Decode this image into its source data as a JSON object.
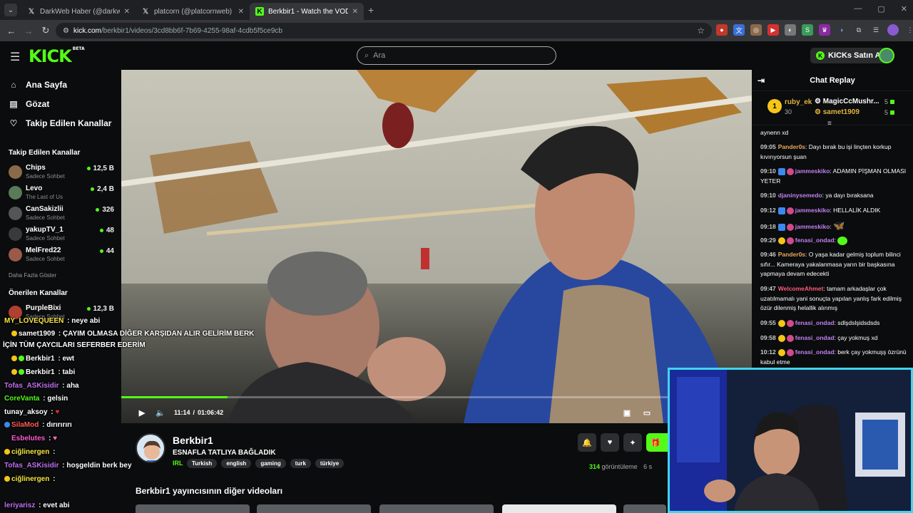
{
  "browser": {
    "tabs": [
      {
        "title": "DarkWeb Haber (@darkwebhaber) / X",
        "icon": "x-icon"
      },
      {
        "title": "platcorn (@platcornweb) / X",
        "icon": "x-icon"
      },
      {
        "title": "Berkbir1 - Watch the VOD on Kick",
        "icon": "kick-icon"
      }
    ],
    "url_host": "kick.com",
    "url_path": "/berkbir1/videos/3cd8bb6f-7b69-4255-98af-4cdb5f5ce9cb"
  },
  "header": {
    "logo": "KICK",
    "logo_badge": "BETA",
    "search_placeholder": "Ara",
    "buy_label": "KICKs Satın Al"
  },
  "sidebar": {
    "nav": [
      {
        "label": "Ana Sayfa",
        "icon": "home-icon"
      },
      {
        "label": "Gözat",
        "icon": "browse-icon"
      },
      {
        "label": "Takip Edilen Kanallar",
        "icon": "heart-icon"
      }
    ],
    "followed_heading": "Takip Edilen Kanallar",
    "followed": [
      {
        "name": "Chips",
        "category": "Sadece Sohbet",
        "viewers": "12,5 B",
        "color": "#8a6a4a"
      },
      {
        "name": "Levo",
        "category": "The Last of Us",
        "viewers": "2,4 B",
        "color": "#5a7a5a"
      },
      {
        "name": "CanSakizlii",
        "category": "Sadece Sohbet",
        "viewers": "326",
        "color": "#555555"
      },
      {
        "name": "yakupTV_1",
        "category": "Sadece Sohbet",
        "viewers": "48",
        "color": "#3a3a3a"
      },
      {
        "name": "MelFred22",
        "category": "Sadece Sohbet",
        "viewers": "44",
        "color": "#9a5a4a"
      }
    ],
    "more_label": "Daha Fazla Göster",
    "recommended_heading": "Önerilen Kanallar",
    "recommended_top": {
      "name": "PurpleBixi",
      "category": "Sadece Sohbet",
      "viewers": "12,3 B",
      "color": "#b04030"
    }
  },
  "overlay_chat": [
    {
      "user": "MY_LOVEQUEEN",
      "text": " : neye abi",
      "color": "#f5e642"
    },
    {
      "user": "samet1909",
      "text": " : ÇAYIM OLMASA DİĞER KARŞIDAN ALIR GELİRİM BERK",
      "color": "#ffffff"
    },
    {
      "user": "",
      "text": "İÇİN TÜM ÇAYCILARI SEFERBER EDERİM",
      "color": "#ffffff"
    },
    {
      "user": "Berkbir1",
      "text": " : ewt",
      "color": "#ffffff"
    },
    {
      "user": "Berkbir1",
      "text": " : tabi",
      "color": "#ffffff"
    },
    {
      "user": "Tofas_ASKisidir",
      "text": " : aha",
      "color": "#c070f0"
    },
    {
      "user": "CoreVanta",
      "text": " : gelsin",
      "color": "#53fc18"
    },
    {
      "user": "tunay_aksoy",
      "text": " : ",
      "color": "#ffffff"
    },
    {
      "user": "SilaMod",
      "text": " : dırırırırı",
      "color": "#ff5a5a"
    },
    {
      "user": "Esbelutes",
      "text": " : ",
      "color": "#ff5ad0"
    },
    {
      "user": "ciğlinergen",
      "text": " : ",
      "color": "#f5e642"
    },
    {
      "user": "Tofas_ASKisidir",
      "text": " : hoşgeldin berk bey",
      "color": "#c070f0"
    },
    {
      "user": "ciğlinergen",
      "text": " : ",
      "color": "#f5e642"
    },
    {
      "user": "leriyarisz",
      "text": " : evet abi",
      "color": "#c070f0"
    }
  ],
  "player": {
    "time_current": "11:14",
    "time_total": "01:06:42",
    "progress": 0.168
  },
  "stream": {
    "name": "Berkbir1",
    "title": "ESNAFLA TATLIYA BAĞLADIK",
    "category": "IRL",
    "tags": [
      "Turkish",
      "english",
      "gaming",
      "turk",
      "türkiye"
    ],
    "views_count": "314",
    "views_label": "görüntüleme",
    "age": "6 s",
    "other_videos_heading": "Berkbir1 yayıncısının diğer videoları"
  },
  "chat": {
    "title": "Chat Replay",
    "gift_top": {
      "rank": "1",
      "name": "ruby_ek",
      "count": "30"
    },
    "gift_list": [
      {
        "name": "MagicCcMushr...",
        "value": "5"
      },
      {
        "name": "samet1909",
        "value": "5"
      }
    ],
    "messages": [
      {
        "time": "",
        "user": "",
        "text": "aynenn xd",
        "ucolor": "#ffffff"
      },
      {
        "time": "09:05",
        "user": "Pander0s",
        "text": ": Dayı bırak bu işi linçten korkup kıvırıyorsun şuan",
        "ucolor": "#e8a860"
      },
      {
        "time": "09:10",
        "user": "jammeskiko",
        "text": ": ADAMIN PİŞMAN OLMASI YETER",
        "ucolor": "#c080f0"
      },
      {
        "time": "09:10",
        "user": "djaninysemedo",
        "text": ": ya dayı bıraksana",
        "ucolor": "#c080f0"
      },
      {
        "time": "09:12",
        "user": "jammeskiko",
        "text": ": HELLALİK ALDIK",
        "ucolor": "#c080f0"
      },
      {
        "time": "09:18",
        "user": "jammeskiko",
        "text": ":",
        "ucolor": "#c080f0"
      },
      {
        "time": "09:29",
        "user": "fenasi_ondad",
        "text": ":",
        "ucolor": "#c080f0"
      },
      {
        "time": "09:46",
        "user": "Pander0s",
        "text": ": O yaşa kadar gelmiş toplum bilinci sıfır... Kameraya yakalanmasa yarın bir başkasına yapmaya devam edecekti",
        "ucolor": "#e8a860"
      },
      {
        "time": "09:47",
        "user": "WelcomeAhmet",
        "text": ": tamam arkadaşlar çok uzatılmamalı yani sonuçta yapılan yanlış fark edilmiş özür dilenmiş helallik alınmış",
        "ucolor": "#ff5a7a"
      },
      {
        "time": "09:55",
        "user": "fenasi_ondad",
        "text": ": sdlşdslşidsdsds",
        "ucolor": "#c080f0"
      },
      {
        "time": "09:58",
        "user": "fenasi_ondad",
        "text": ": çay yokmuş xd",
        "ucolor": "#c080f0"
      },
      {
        "time": "10:12",
        "user": "fenasi_ondad",
        "text": ": berk çay yokmuşş özrünü kabul etme",
        "ucolor": "#c080f0"
      }
    ]
  }
}
